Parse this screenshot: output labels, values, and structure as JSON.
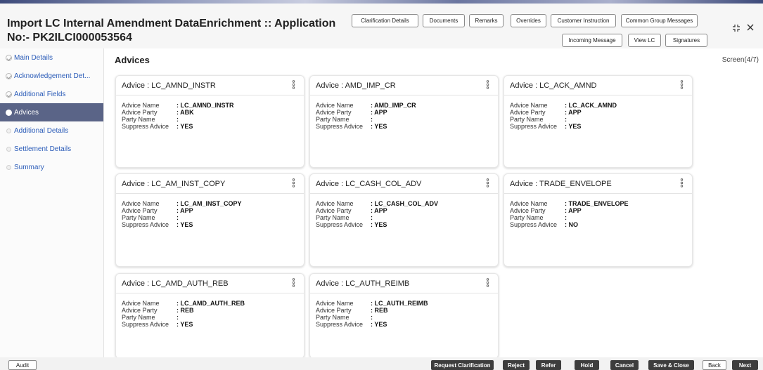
{
  "header": {
    "title": "Import LC Internal Amendment DataEnrichment :: Application No:- PK2ILCI000053564",
    "buttons_row1": [
      {
        "name": "clarification-details-button",
        "label": "Clarification Details"
      },
      {
        "name": "documents-button",
        "label": "Documents"
      },
      {
        "name": "remarks-button",
        "label": "Remarks"
      },
      {
        "name": "overrides-button",
        "label": "Overrides"
      },
      {
        "name": "customer-instruction-button",
        "label": "Customer Instruction"
      },
      {
        "name": "common-group-messages-button",
        "label": "Common Group Messages"
      }
    ],
    "buttons_row2": [
      {
        "name": "incoming-message-button",
        "label": "Incoming Message"
      },
      {
        "name": "view-lc-button",
        "label": "View LC"
      },
      {
        "name": "signatures-button",
        "label": "Signatures"
      }
    ],
    "window_controls": {
      "expand_icon": "expand-icon",
      "close_icon": "close-icon"
    }
  },
  "sidebar": {
    "items": [
      {
        "label": "Main Details",
        "state": "done"
      },
      {
        "label": "Acknowledgement Det...",
        "state": "done"
      },
      {
        "label": "Additional Fields",
        "state": "done"
      },
      {
        "label": "Advices",
        "state": "active"
      },
      {
        "label": "Additional Details",
        "state": "pending"
      },
      {
        "label": "Settlement Details",
        "state": "pending"
      },
      {
        "label": "Summary",
        "state": "pending"
      }
    ]
  },
  "main": {
    "title": "Advices",
    "screen_indicator": "Screen(4/7)",
    "field_labels": {
      "advice_name": "Advice Name",
      "advice_party": "Advice Party",
      "party_name": "Party Name",
      "suppress_advice": "Suppress Advice"
    },
    "advices": [
      {
        "title": "Advice : LC_AMND_INSTR",
        "advice_name": ": LC_AMND_INSTR",
        "advice_party": ": ABK",
        "party_name": ":",
        "suppress_advice": ": YES"
      },
      {
        "title": "Advice : AMD_IMP_CR",
        "advice_name": ": AMD_IMP_CR",
        "advice_party": ": APP",
        "party_name": ":",
        "suppress_advice": ": YES"
      },
      {
        "title": "Advice : LC_ACK_AMND",
        "advice_name": ": LC_ACK_AMND",
        "advice_party": ": APP",
        "party_name": ":",
        "suppress_advice": ": YES"
      },
      {
        "title": "Advice : LC_AM_INST_COPY",
        "advice_name": ": LC_AM_INST_COPY",
        "advice_party": ": APP",
        "party_name": ":",
        "suppress_advice": ": YES"
      },
      {
        "title": "Advice : LC_CASH_COL_ADV",
        "advice_name": ": LC_CASH_COL_ADV",
        "advice_party": ": APP",
        "party_name": ":",
        "suppress_advice": ": YES"
      },
      {
        "title": "Advice : TRADE_ENVELOPE",
        "advice_name": ": TRADE_ENVELOPE",
        "advice_party": ": APP",
        "party_name": ":",
        "suppress_advice": ": NO"
      },
      {
        "title": "Advice : LC_AMD_AUTH_REB",
        "advice_name": ": LC_AMD_AUTH_REB",
        "advice_party": ": REB",
        "party_name": ":",
        "suppress_advice": ": YES"
      },
      {
        "title": "Advice : LC_AUTH_REIMB",
        "advice_name": ": LC_AUTH_REIMB",
        "advice_party": ": REB",
        "party_name": ":",
        "suppress_advice": ": YES"
      }
    ]
  },
  "footer": {
    "audit": "Audit",
    "actions": [
      {
        "name": "request-clarification-button",
        "label": "Request Clarification"
      },
      {
        "name": "reject-button",
        "label": "Reject"
      },
      {
        "name": "refer-button",
        "label": "Refer"
      },
      {
        "name": "hold-button",
        "label": "Hold"
      },
      {
        "name": "cancel-button",
        "label": "Cancel"
      },
      {
        "name": "save-close-button",
        "label": "Save & Close"
      },
      {
        "name": "back-button",
        "label": "Back"
      },
      {
        "name": "next-button",
        "label": "Next"
      }
    ]
  },
  "colors": {
    "active_nav_bg": "#5a6487",
    "nav_link": "#2b5cb8",
    "dark_button": "#3d3d3d"
  }
}
